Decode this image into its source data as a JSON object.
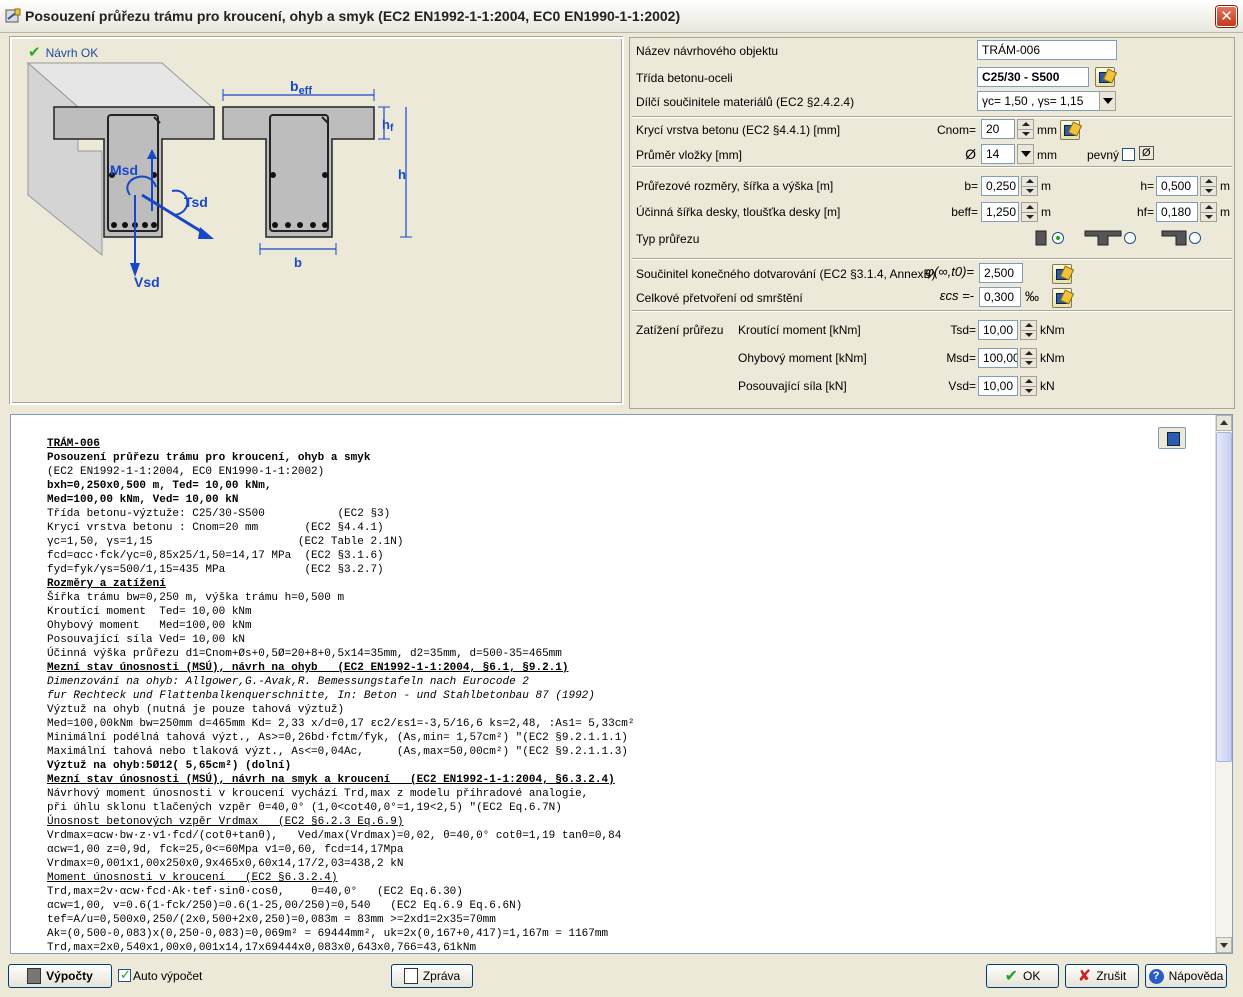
{
  "window": {
    "title": "Posouzení průřezu trámu pro kroucení, ohyb a smyk (EC2 EN1992-1-1:2004, EC0 EN1990-1-1:2002)",
    "close": "✕"
  },
  "status": {
    "label": "Návrh OK"
  },
  "diagram": {
    "msd": "Msd",
    "tsd": "Tsd",
    "vsd": "Vsd",
    "beff": "b",
    "beff_sub": "eff",
    "hf": "h",
    "hf_sub": "f",
    "h": "h",
    "b": "b"
  },
  "form": {
    "name": {
      "label": "Název návrhového objektu",
      "value": "TRÁM-006"
    },
    "concrete": {
      "label": "Třída betonu-oceli",
      "value": "C25/30 - S500"
    },
    "factors": {
      "label": "Dílčí součinitele materiálů (EC2 §2.4.2.4)",
      "value": "γc= 1,50 , γs= 1,15"
    },
    "cover": {
      "label": "Krycí vrstva betonu (EC2 §4.4.1) [mm]",
      "symbol": "Cnom=",
      "value": "20",
      "unit": "mm"
    },
    "bar_diam": {
      "label": "Průměr vložky [mm]",
      "symbol": "Ø",
      "value": "14",
      "unit": "mm",
      "fixed_label": "pevný Ø",
      "fixed_icon": "Ø"
    },
    "dims": {
      "label": "Průřezové rozměry, šířka a výška [m]",
      "b_symbol": "b=",
      "b_value": "0,250",
      "b_unit": "m",
      "h_symbol": "h=",
      "h_value": "0,500",
      "h_unit": "m"
    },
    "flange": {
      "label": "Účinná šířka desky, tloušťka desky [m]",
      "beff_symbol": "beff=",
      "beff_value": "1,250",
      "beff_unit": "m",
      "hf_symbol": "hf=",
      "hf_value": "0,180",
      "hf_unit": "m"
    },
    "type": {
      "label": "Typ průřezu"
    },
    "creep": {
      "label": "Součinitel konečného dotvarování (EC2 §3.1.4, AnnexB)",
      "symbol": "φ(∞,t0)=",
      "value": "2,500"
    },
    "shrink": {
      "label": "Celkové přetvoření od smrštění",
      "symbol": "εcs =-",
      "value": "0,300",
      "unit": "‰"
    },
    "loads": {
      "label": "Zatížení průřezu",
      "tsd": {
        "label": "Kroutící moment [kNm]",
        "symbol": "Tsd=",
        "value": "10,00",
        "unit": "kNm"
      },
      "msd": {
        "label": "Ohybový moment [kNm]",
        "symbol": "Msd=",
        "value": "100,00",
        "unit": "kNm"
      },
      "vsd": {
        "label": "Posouvající síla [kN]",
        "symbol": "Vsd=",
        "value": "10,00",
        "unit": "kN"
      }
    }
  },
  "report": {
    "lines": [
      "TRÁM-006",
      "Posouzení průřezu trámu pro kroucení, ohyb a smyk",
      "(EC2 EN1992-1-1:2004, EC0 EN1990-1-1:2002)",
      "bxh=0,250x0,500 m, Ted= 10,00 kNm,",
      "Med=100,00 kNm, Ved= 10,00 kN",
      "Třída betonu-výztuže: C25/30-S500           (EC2 §3)",
      "Krycí vrstva betonu : Cnom=20 mm       (EC2 §4.4.1)",
      "γc=1,50, γs=1,15                      (EC2 Table 2.1N)",
      "fcd=αcc·fck/γc=0,85x25/1,50=14,17 MPa  (EC2 §3.1.6)",
      "fyd=fyk/γs=500/1,15=435 MPa            (EC2 §3.2.7)",
      "Rozměry a zatížení",
      "Šířka trámu bw=0,250 m, výška trámu h=0,500 m",
      "Kroutící moment  Ted= 10,00 kNm",
      "Ohybový moment   Med=100,00 kNm",
      "Posouvající síla Ved= 10,00 kN",
      "Účinná výška průřezu d1=Cnom+Øs+0,5Ø=20+8+0,5x14=35mm, d2=35mm, d=500-35=465mm",
      "Mezní stav únosnosti (MSÚ), návrh na ohyb   (EC2 EN1992-1-1:2004, §6.1, §9.2.1)",
      "Dimenzování na ohyb: Allgower,G.-Avak,R. Bemessungstafeln nach Eurocode 2",
      "fur Rechteck und Flattenbalkenquerschnitte, In: Beton - und Stahlbetonbau 87 (1992)",
      "Výztuž na ohyb (nutná je pouze tahová výztuž)",
      "Med=100,00kNm bw=250mm d=465mm Kd= 2,33 x/d=0,17 εc2/εs1=-3,5/16,6 ks=2,48, :As1= 5,33cm²",
      "Minimální podélná tahová výzt., As>=0,26bd·fctm/fyk, (As,min= 1,57cm²) \"(EC2 §9.2.1.1.1)",
      "Maximální tahová nebo tlaková výzt., As<=0,04Ac,     (As,max=50,00cm²) \"(EC2 §9.2.1.1.3)",
      "Výztuž na ohyb:5Ø12( 5,65cm²) (dolní)",
      "Mezní stav únosnosti (MSÚ), návrh na smyk a kroucení   (EC2 EN1992-1-1:2004, §6.3.2.4)",
      "Návrhový moment únosnosti v kroucení vychází Trd,max z modelu příhradové analogie,",
      "při úhlu sklonu tlačených vzpěr θ=40,0° (1,0<cot40,0°=1,19<2,5) \"(EC2 Eq.6.7N)",
      "Únosnost betonových vzpěr Vrdmax   (EC2 §6.2.3 Eq.6.9)",
      "Vrdmax=αcw·bw·z·v1·fcd/(cotθ+tanθ),   Ved/max(Vrdmax)=0,02, θ=40,0° cotθ=1,19 tanθ=0,84",
      "αcw=1,00 z=0,9d, fck=25,0<=60Mpa v1=0,60, fcd=14,17Mpa",
      "Vrdmax=0,001x1,00x250x0,9x465x0,60x14,17/2,03=438,2 kN",
      "Moment únosnosti v kroucení   (EC2 §6.3.2.4)",
      "Trd,max=2v·αcw·fcd·Ak·tef·sinθ·cosθ,    θ=40,0°   (EC2 Eq.6.30)",
      "αcw=1,00, v=0.6(1-fck/250)=0.6(1-25,00/250)=0,540   (EC2 Eq.6.9 Eq.6.6N)",
      "tef=A/u=0,500x0,250/(2x0,500+2x0,250)=0,083m = 83mm >=2xd1=2x35=70mm",
      "Ak=(0,500-0,083)x(0,250-0,083)=0,069m² = 69444mm², uk=2x(0,167+0,417)=1,167m = 1167mm",
      "Trd,max=2x0,540x1,00x0,001x14,17x69444x0,083x0,643x0,766=43,61kNm"
    ]
  },
  "buttons": {
    "vypocty": "Výpočty",
    "auto": "Auto výpočet",
    "zprava": "Zpráva",
    "ok": "OK",
    "zrusit": "Zrušit",
    "napoveda": "Nápověda"
  }
}
